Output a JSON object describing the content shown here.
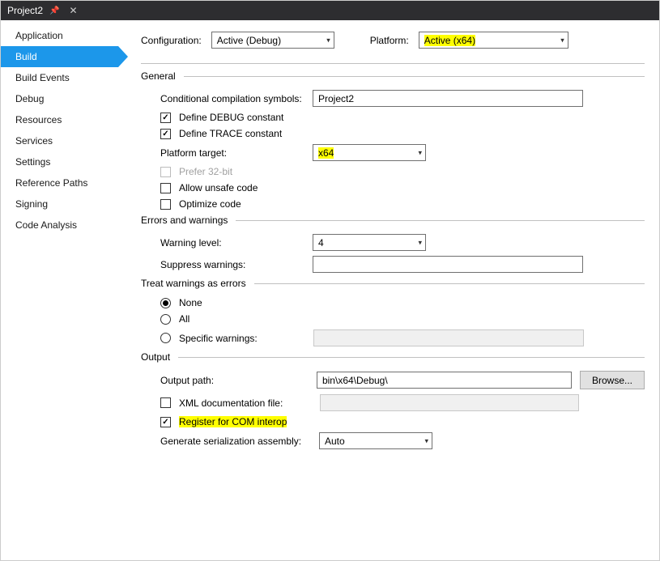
{
  "title": "Project2",
  "sidebar": {
    "items": [
      {
        "label": "Application"
      },
      {
        "label": "Build"
      },
      {
        "label": "Build Events"
      },
      {
        "label": "Debug"
      },
      {
        "label": "Resources"
      },
      {
        "label": "Services"
      },
      {
        "label": "Settings"
      },
      {
        "label": "Reference Paths"
      },
      {
        "label": "Signing"
      },
      {
        "label": "Code Analysis"
      }
    ],
    "active_index": 1
  },
  "toprow": {
    "config_label": "Configuration:",
    "config_value": "Active (Debug)",
    "platform_label": "Platform:",
    "platform_value": "Active (x64)"
  },
  "sections": {
    "general": {
      "title": "General",
      "cond_label": "Conditional compilation symbols:",
      "cond_value": "Project2",
      "debug_label": "Define DEBUG constant",
      "trace_label": "Define TRACE constant",
      "ptarget_label": "Platform target:",
      "ptarget_value": "x64",
      "prefer32_label": "Prefer 32-bit",
      "unsafe_label": "Allow unsafe code",
      "optimize_label": "Optimize code"
    },
    "errors": {
      "title": "Errors and warnings",
      "wlevel_label": "Warning level:",
      "wlevel_value": "4",
      "suppress_label": "Suppress warnings:",
      "suppress_value": ""
    },
    "treat": {
      "title": "Treat warnings as errors",
      "none_label": "None",
      "all_label": "All",
      "specific_label": "Specific warnings:",
      "specific_value": ""
    },
    "output": {
      "title": "Output",
      "outpath_label": "Output path:",
      "outpath_value": "bin\\x64\\Debug\\",
      "browse_label": "Browse...",
      "xmldoc_label": "XML documentation file:",
      "xmldoc_value": "",
      "regcom_label": "Register for COM interop",
      "genser_label": "Generate serialization assembly:",
      "genser_value": "Auto"
    }
  }
}
